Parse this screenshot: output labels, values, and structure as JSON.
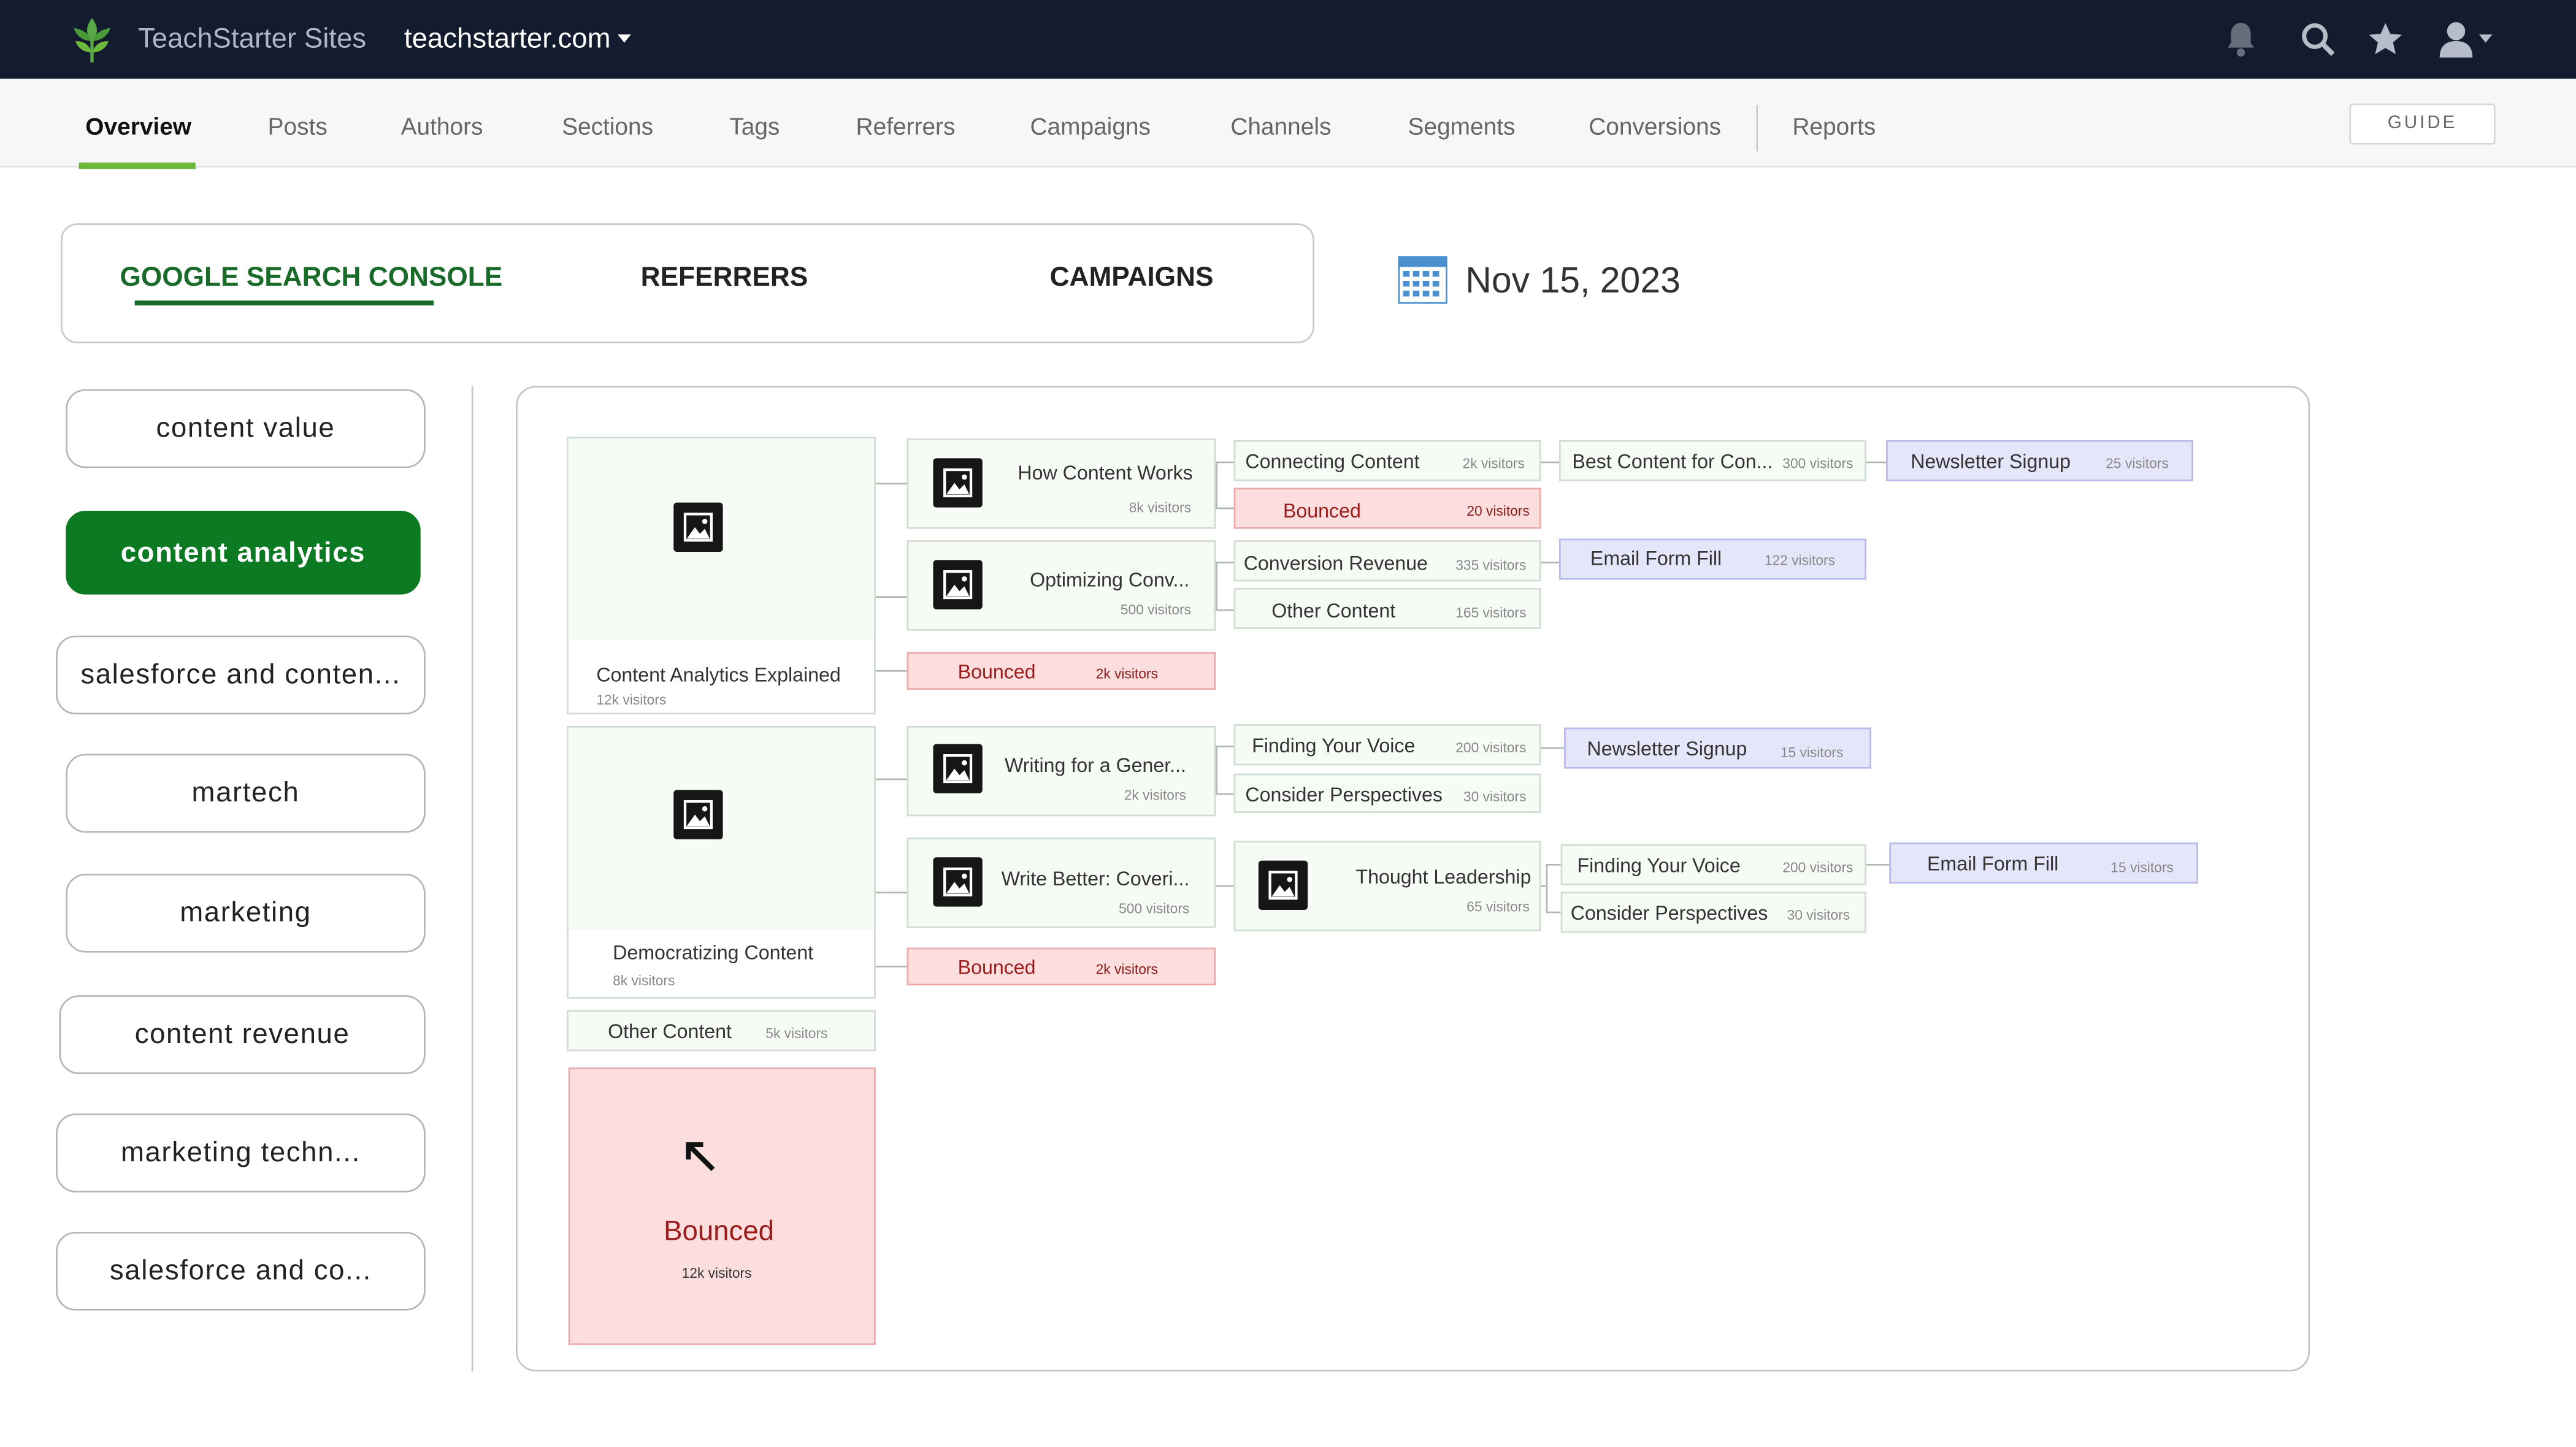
{
  "app": {
    "brand": "TeachStarter Sites",
    "site": "teachstarter.com"
  },
  "nav": {
    "tabs": [
      "Overview",
      "Posts",
      "Authors",
      "Sections",
      "Tags",
      "Referrers",
      "Campaigns",
      "Channels",
      "Segments",
      "Conversions",
      "Reports"
    ],
    "active": "Overview",
    "guide_label": "GUIDE"
  },
  "sources": {
    "tabs": [
      "GOOGLE SEARCH CONSOLE",
      "REFERRERS",
      "CAMPAIGNS"
    ],
    "active": "GOOGLE SEARCH CONSOLE"
  },
  "date": "Nov 15, 2023",
  "topics": {
    "items": [
      "content value",
      "content analytics",
      "salesforce and conten...",
      "martech",
      "marketing",
      "content revenue",
      "marketing techn...",
      "salesforce and co..."
    ],
    "active": "content analytics"
  },
  "flow": {
    "entries": [
      {
        "title": "Content Analytics Explained",
        "visitors": "12k visitors"
      },
      {
        "title": "Democratizing Content",
        "visitors": "8k visitors"
      }
    ],
    "other": {
      "label": "Other Content",
      "visitors": "5k visitors"
    },
    "bounced_total": {
      "label": "Bounced",
      "visitors": "12k visitors"
    },
    "level1": [
      {
        "title": "How Content Works",
        "visitors": "8k visitors"
      },
      {
        "title": "Optimizing Conv...",
        "visitors": "500 visitors"
      },
      {
        "label": "Bounced",
        "visitors": "2k visitors"
      },
      {
        "title": "Writing for a Gener...",
        "visitors": "2k visitors"
      },
      {
        "title": "Write Better: Coveri...",
        "visitors": "500 visitors"
      },
      {
        "label": "Bounced",
        "visitors": "2k visitors"
      }
    ],
    "level2": [
      {
        "label": "Connecting Content",
        "visitors": "2k visitors"
      },
      {
        "label": "Bounced",
        "visitors": "20 visitors"
      },
      {
        "label": "Conversion Revenue",
        "visitors": "335 visitors"
      },
      {
        "label": "Other Content",
        "visitors": "165 visitors"
      },
      {
        "label": "Finding Your Voice",
        "visitors": "200 visitors"
      },
      {
        "label": "Consider Perspectives",
        "visitors": "30 visitors"
      },
      {
        "title": "Thought Leadership",
        "visitors": "65 visitors"
      }
    ],
    "level3": [
      {
        "label": "Best Content for Con...",
        "visitors": "300 visitors"
      },
      {
        "label": "Email Form Fill",
        "visitors": "122 visitors"
      },
      {
        "label": "Newsletter Signup",
        "visitors": "15 visitors"
      },
      {
        "label": "Finding Your Voice",
        "visitors": "200 visitors"
      },
      {
        "label": "Consider Perspectives",
        "visitors": "30 visitors"
      }
    ],
    "level4": [
      {
        "label": "Newsletter Signup",
        "visitors": "25 visitors"
      },
      {
        "label": "Email Form Fill",
        "visitors": "15 visitors"
      }
    ]
  },
  "colors": {
    "topbar": "#131c2e",
    "accent_green": "#0c7a22",
    "nav_underline": "#6bb83a",
    "bounced_bg": "#fcdede",
    "conversion_bg": "#e6e6fb",
    "node_bg": "#f6fcf5"
  }
}
